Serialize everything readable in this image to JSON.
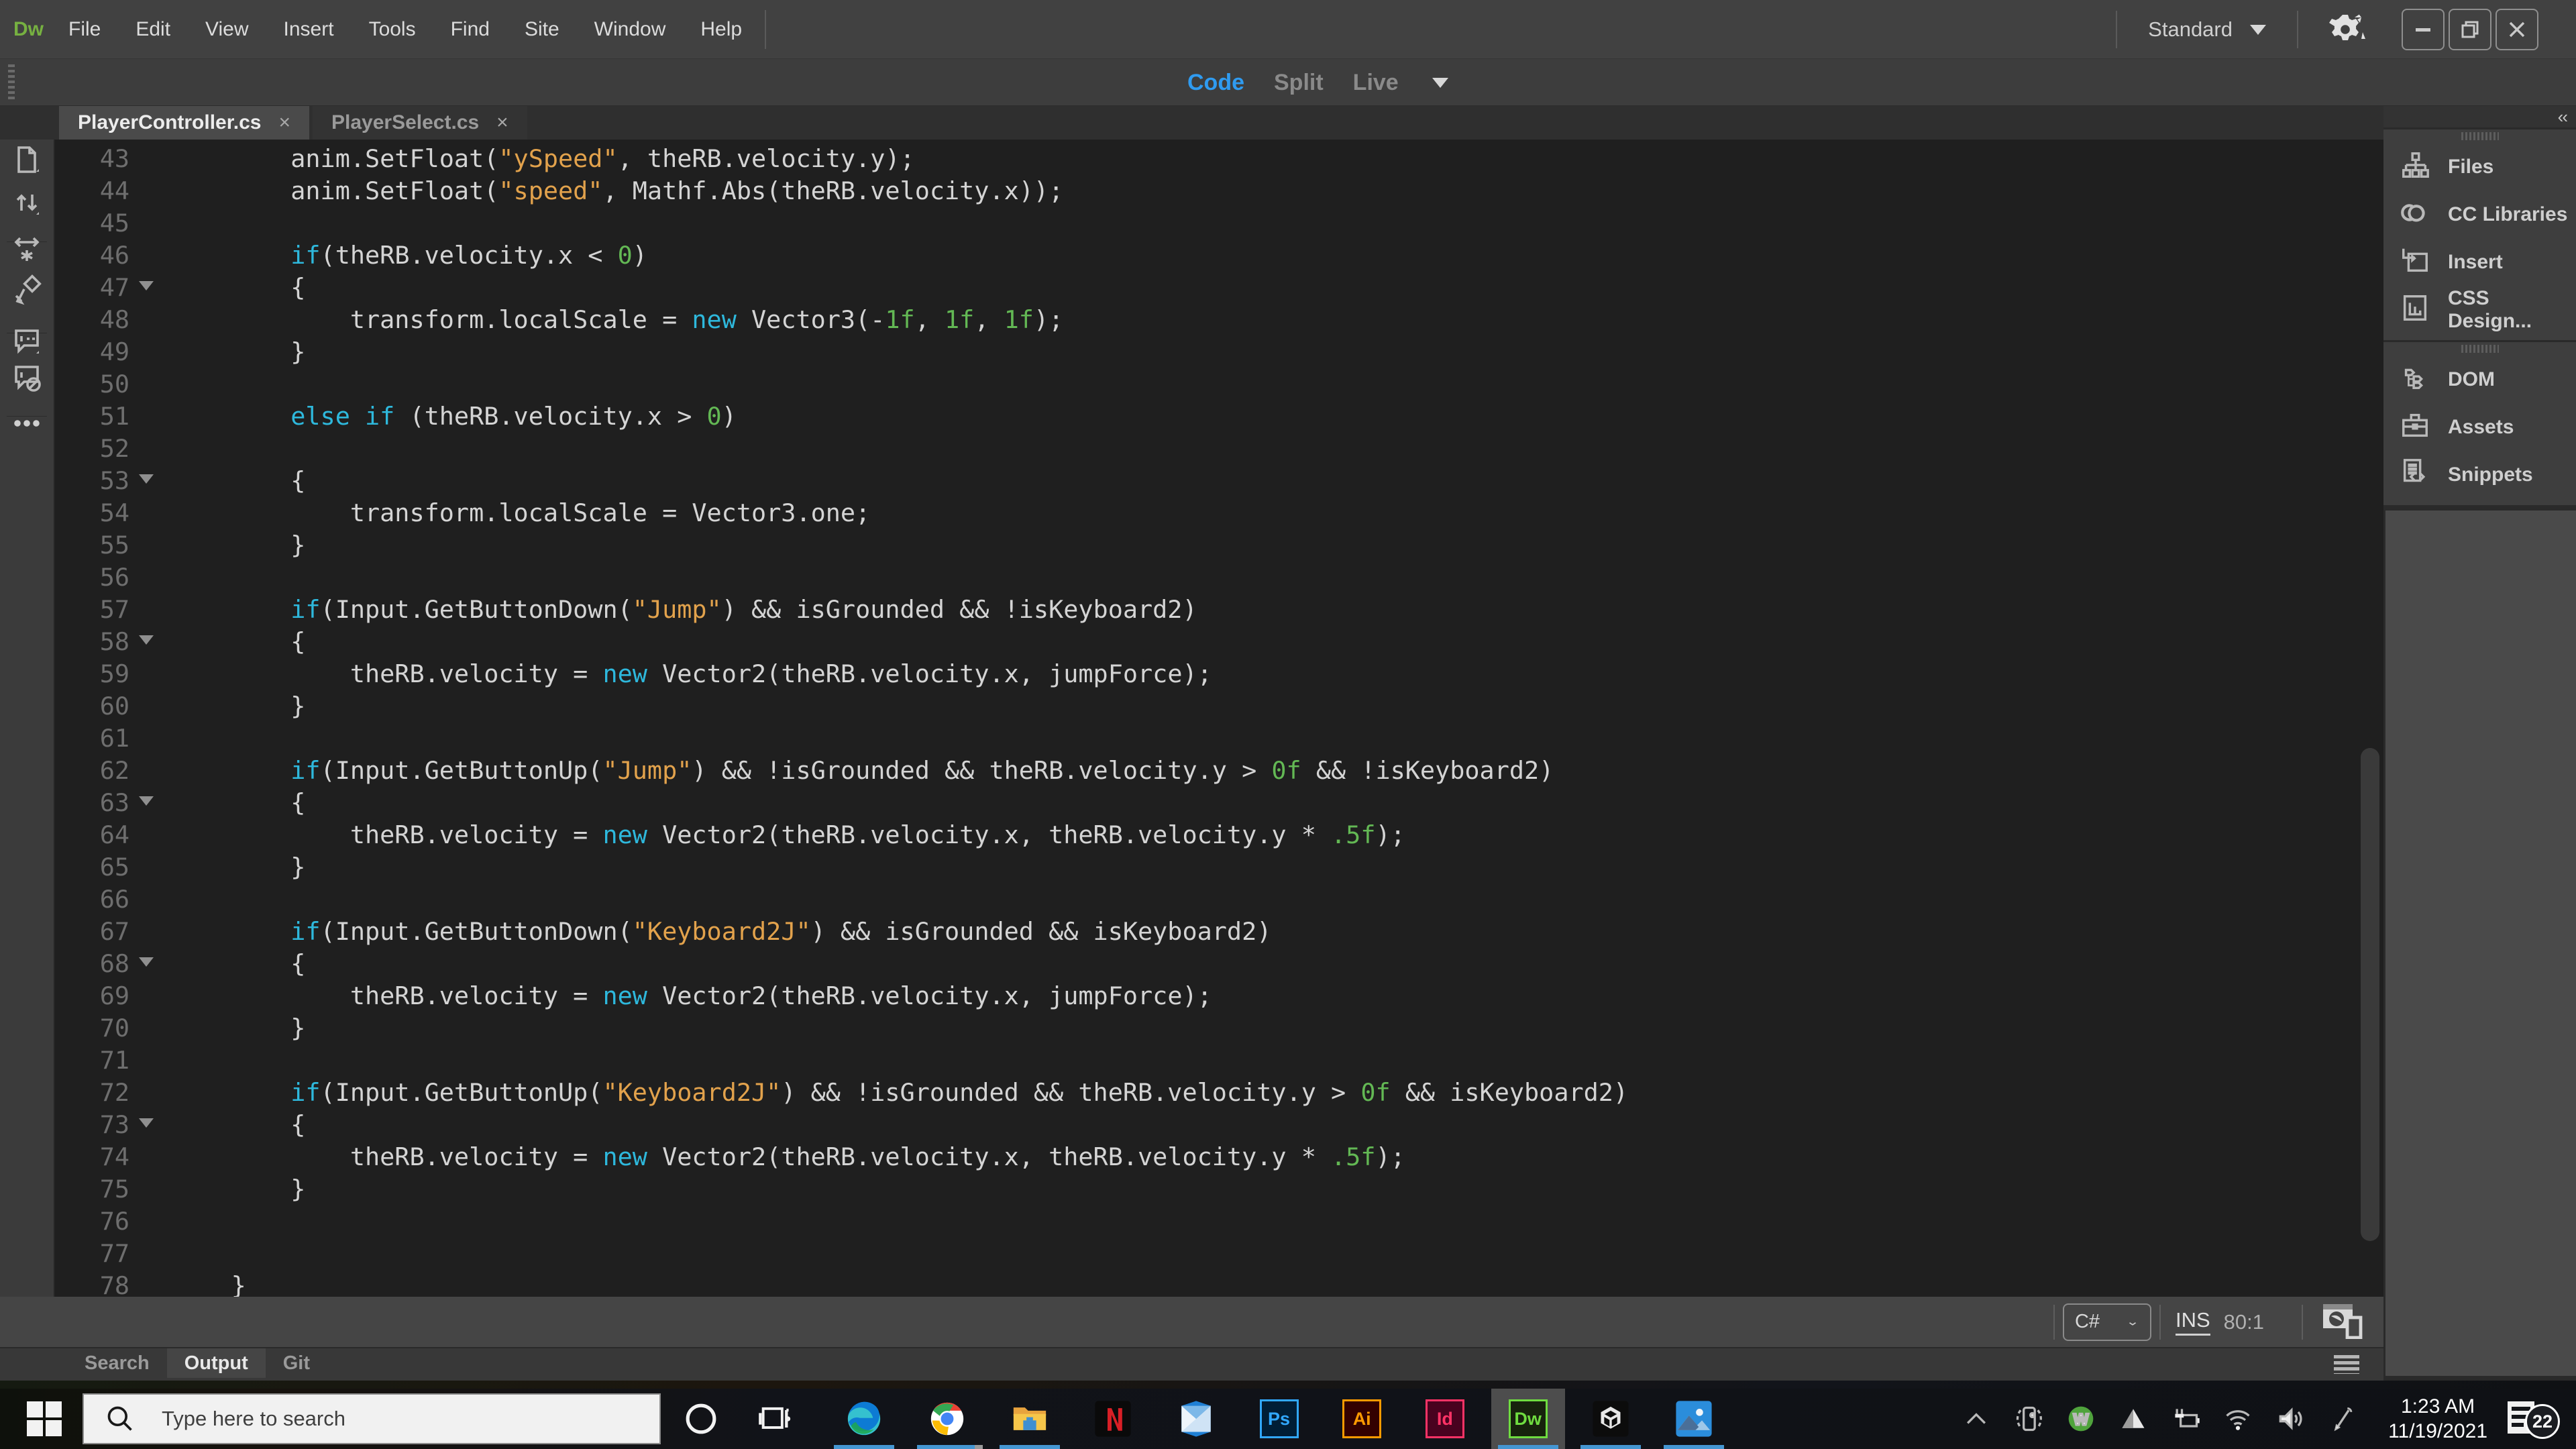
{
  "colors": {
    "dw_green": "#76b041",
    "code_blue": "#2f9bf0",
    "inactive_mode": "#8a8a8a",
    "keyword": "#2eb8dc",
    "string": "#e2a24c",
    "number": "#63b854",
    "taskbar_accent": "#4596d2"
  },
  "menu": {
    "logo": "Dw",
    "items": [
      "File",
      "Edit",
      "View",
      "Insert",
      "Tools",
      "Find",
      "Site",
      "Window",
      "Help"
    ]
  },
  "titlebar": {
    "workspace": "Standard",
    "minimize": "–",
    "restore": "❐",
    "close": "✕"
  },
  "view_modes": {
    "code": "Code",
    "split": "Split",
    "live": "Live"
  },
  "tabs": [
    {
      "label": "PlayerController.cs",
      "close": "×",
      "active": true
    },
    {
      "label": "PlayerSelect.cs",
      "close": "×",
      "active": false
    }
  ],
  "left_toolbar_icons": [
    "open-documents-icon",
    "file-management-icon",
    "divider",
    "find-replace-icon",
    "apply-format-icon",
    "divider",
    "apply-comment-icon",
    "remove-comment-icon",
    "divider",
    "more-options-icon"
  ],
  "editor": {
    "lines": [
      {
        "n": 43,
        "f": false,
        "t": [
          [
            "d",
            "        anim.SetFloat("
          ],
          [
            "s",
            "\"ySpeed\""
          ],
          [
            "d",
            ", theRB.velocity.y);"
          ]
        ]
      },
      {
        "n": 44,
        "f": false,
        "t": [
          [
            "d",
            "        anim.SetFloat("
          ],
          [
            "s",
            "\"speed\""
          ],
          [
            "d",
            ", Mathf.Abs(theRB.velocity.x));"
          ]
        ]
      },
      {
        "n": 45,
        "f": false,
        "t": []
      },
      {
        "n": 46,
        "f": false,
        "t": [
          [
            "k",
            "        if"
          ],
          [
            "d",
            "(theRB.velocity.x < "
          ],
          [
            "n",
            "0"
          ],
          [
            "d",
            ")"
          ]
        ]
      },
      {
        "n": 47,
        "f": true,
        "t": [
          [
            "d",
            "        {"
          ]
        ]
      },
      {
        "n": 48,
        "f": false,
        "t": [
          [
            "d",
            "            transform.localScale = "
          ],
          [
            "k",
            "new"
          ],
          [
            "d",
            " Vector3(-"
          ],
          [
            "n",
            "1f"
          ],
          [
            "d",
            ", "
          ],
          [
            "n",
            "1f"
          ],
          [
            "d",
            ", "
          ],
          [
            "n",
            "1f"
          ],
          [
            "d",
            ");"
          ]
        ]
      },
      {
        "n": 49,
        "f": false,
        "t": [
          [
            "d",
            "        }"
          ]
        ]
      },
      {
        "n": 50,
        "f": false,
        "t": []
      },
      {
        "n": 51,
        "f": false,
        "t": [
          [
            "k",
            "        else"
          ],
          [
            "d",
            " "
          ],
          [
            "k",
            "if"
          ],
          [
            "d",
            " (theRB.velocity.x > "
          ],
          [
            "n",
            "0"
          ],
          [
            "d",
            ")"
          ]
        ]
      },
      {
        "n": 52,
        "f": false,
        "t": []
      },
      {
        "n": 53,
        "f": true,
        "t": [
          [
            "d",
            "        {"
          ]
        ]
      },
      {
        "n": 54,
        "f": false,
        "t": [
          [
            "d",
            "            transform.localScale = Vector3.one;"
          ]
        ]
      },
      {
        "n": 55,
        "f": false,
        "t": [
          [
            "d",
            "        }"
          ]
        ]
      },
      {
        "n": 56,
        "f": false,
        "t": []
      },
      {
        "n": 57,
        "f": false,
        "t": [
          [
            "k",
            "        if"
          ],
          [
            "d",
            "(Input.GetButtonDown("
          ],
          [
            "s",
            "\"Jump\""
          ],
          [
            "d",
            ") && isGrounded && !isKeyboard2)"
          ]
        ]
      },
      {
        "n": 58,
        "f": true,
        "t": [
          [
            "d",
            "        {"
          ]
        ]
      },
      {
        "n": 59,
        "f": false,
        "t": [
          [
            "d",
            "            theRB.velocity = "
          ],
          [
            "k",
            "new"
          ],
          [
            "d",
            " Vector2(theRB.velocity.x, jumpForce);"
          ]
        ]
      },
      {
        "n": 60,
        "f": false,
        "t": [
          [
            "d",
            "        }"
          ]
        ]
      },
      {
        "n": 61,
        "f": false,
        "t": []
      },
      {
        "n": 62,
        "f": false,
        "t": [
          [
            "k",
            "        if"
          ],
          [
            "d",
            "(Input.GetButtonUp("
          ],
          [
            "s",
            "\"Jump\""
          ],
          [
            "d",
            ") && !isGrounded && theRB.velocity.y > "
          ],
          [
            "n",
            "0f"
          ],
          [
            "d",
            " && !isKeyboard2)"
          ]
        ]
      },
      {
        "n": 63,
        "f": true,
        "t": [
          [
            "d",
            "        {"
          ]
        ]
      },
      {
        "n": 64,
        "f": false,
        "t": [
          [
            "d",
            "            theRB.velocity = "
          ],
          [
            "k",
            "new"
          ],
          [
            "d",
            " Vector2(theRB.velocity.x, theRB.velocity.y * "
          ],
          [
            "n",
            ".5f"
          ],
          [
            "d",
            ");"
          ]
        ]
      },
      {
        "n": 65,
        "f": false,
        "t": [
          [
            "d",
            "        }"
          ]
        ]
      },
      {
        "n": 66,
        "f": false,
        "t": []
      },
      {
        "n": 67,
        "f": false,
        "t": [
          [
            "k",
            "        if"
          ],
          [
            "d",
            "(Input.GetButtonDown("
          ],
          [
            "s",
            "\"Keyboard2J\""
          ],
          [
            "d",
            ") && isGrounded && isKeyboard2)"
          ]
        ]
      },
      {
        "n": 68,
        "f": true,
        "t": [
          [
            "d",
            "        {"
          ]
        ]
      },
      {
        "n": 69,
        "f": false,
        "t": [
          [
            "d",
            "            theRB.velocity = "
          ],
          [
            "k",
            "new"
          ],
          [
            "d",
            " Vector2(theRB.velocity.x, jumpForce);"
          ]
        ]
      },
      {
        "n": 70,
        "f": false,
        "t": [
          [
            "d",
            "        }"
          ]
        ]
      },
      {
        "n": 71,
        "f": false,
        "t": []
      },
      {
        "n": 72,
        "f": false,
        "t": [
          [
            "k",
            "        if"
          ],
          [
            "d",
            "(Input.GetButtonUp("
          ],
          [
            "s",
            "\"Keyboard2J\""
          ],
          [
            "d",
            ") && !isGrounded && theRB.velocity.y > "
          ],
          [
            "n",
            "0f"
          ],
          [
            "d",
            " && isKeyboard2)"
          ]
        ]
      },
      {
        "n": 73,
        "f": true,
        "t": [
          [
            "d",
            "        {"
          ]
        ]
      },
      {
        "n": 74,
        "f": false,
        "t": [
          [
            "d",
            "            theRB.velocity = "
          ],
          [
            "k",
            "new"
          ],
          [
            "d",
            " Vector2(theRB.velocity.x, theRB.velocity.y * "
          ],
          [
            "n",
            ".5f"
          ],
          [
            "d",
            ");"
          ]
        ]
      },
      {
        "n": 75,
        "f": false,
        "t": [
          [
            "d",
            "        }"
          ]
        ]
      },
      {
        "n": 76,
        "f": false,
        "t": []
      },
      {
        "n": 77,
        "f": false,
        "t": []
      },
      {
        "n": 78,
        "f": false,
        "t": [
          [
            "d",
            "    }"
          ]
        ]
      }
    ]
  },
  "right_panel": {
    "collapse": "‹‹",
    "groups": [
      {
        "items": [
          {
            "icon": "files-icon",
            "label": "Files"
          },
          {
            "icon": "cc-libraries-icon",
            "label": "CC Libraries"
          },
          {
            "icon": "insert-icon",
            "label": "Insert"
          },
          {
            "icon": "css-designer-icon",
            "label": "CSS Design..."
          }
        ]
      },
      {
        "items": [
          {
            "icon": "dom-icon",
            "label": "DOM"
          },
          {
            "icon": "assets-icon",
            "label": "Assets"
          },
          {
            "icon": "snippets-icon",
            "label": "Snippets"
          }
        ]
      }
    ]
  },
  "statusbar": {
    "language": "C#",
    "chevron": "⌄",
    "insert_mode": "INS",
    "cursor_position": "80:1",
    "preview_icon": "realtime-preview-icon"
  },
  "panel_tabs": [
    {
      "label": "Search",
      "active": false
    },
    {
      "label": "Output",
      "active": true
    },
    {
      "label": "Git",
      "active": false
    }
  ],
  "taskbar": {
    "search_placeholder": "Type here to search",
    "apps": [
      {
        "name": "edge",
        "running": true
      },
      {
        "name": "chrome",
        "running": true,
        "multi": true
      },
      {
        "name": "explorer",
        "running": true
      },
      {
        "name": "netflix",
        "running": false
      },
      {
        "name": "mail",
        "running": false
      },
      {
        "name": "photoshop",
        "running": false,
        "label": "Ps",
        "color": "#31a8ff",
        "bg": "#001e36"
      },
      {
        "name": "illustrator",
        "running": false,
        "label": "Ai",
        "color": "#ff9a00",
        "bg": "#330000"
      },
      {
        "name": "indesign",
        "running": false,
        "label": "Id",
        "color": "#ff3366",
        "bg": "#49021f"
      },
      {
        "name": "dreamweaver",
        "running": true,
        "active": true,
        "label": "Dw",
        "color": "#6fdc40",
        "bg": "#17230d"
      },
      {
        "name": "unity",
        "running": true
      },
      {
        "name": "photos",
        "running": true
      }
    ],
    "tray_icons": [
      "chevron-up-icon",
      "your-phone-icon",
      "webroot-icon",
      "cloud-icon",
      "battery-icon",
      "wifi-icon",
      "volume-icon",
      "pen-icon"
    ],
    "clock": {
      "time": "1:23 AM",
      "date": "11/19/2021"
    },
    "notification_count": "22"
  }
}
